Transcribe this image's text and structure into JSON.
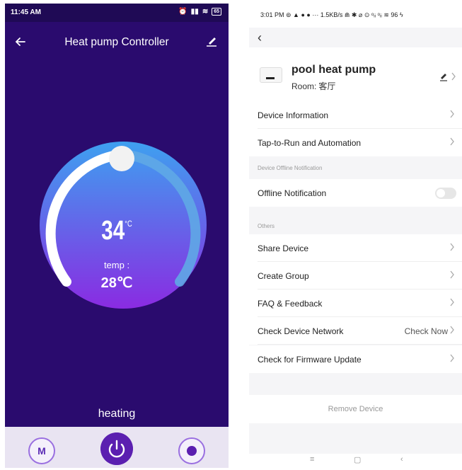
{
  "left_phone": {
    "status": {
      "time": "11:45 AM",
      "battery": "65"
    },
    "header": {
      "title": "Heat pump Controller",
      "back_icon": "arrow-left-icon",
      "edit_icon": "pencil-icon"
    },
    "dial": {
      "set_value": "34",
      "unit": "°C",
      "current_label": "temp :",
      "current_value": "28℃"
    },
    "mode": "heating",
    "bottom": {
      "mode_button": "M",
      "power_icon": "power-icon",
      "timer_icon": "timer-icon"
    },
    "colors": {
      "background": "#2a0b6e",
      "accent": "#5b1fb0",
      "dial_start": "#3ea0f0",
      "dial_end": "#8a2be2"
    }
  },
  "right_phone": {
    "status": {
      "text": "3:01 PM ⊚ ▲ ● ● ··· 1.5KB/s ⋒ ✱ ⌀ ⊙ ᵒᵢᵢ ᵒᵢᵢ ≋ 96 ϟ"
    },
    "device": {
      "name": "pool heat pump",
      "room_label": "Room:",
      "room_value": "客厅"
    },
    "rows": [
      {
        "label": "Device Information"
      },
      {
        "label": "Tap-to-Run and Automation"
      }
    ],
    "offline_section": {
      "header": "Device Offline Notification",
      "label": "Offline Notification",
      "enabled": false
    },
    "others_section": {
      "header": "Others",
      "rows": [
        {
          "label": "Share Device"
        },
        {
          "label": "Create Group"
        },
        {
          "label": "FAQ & Feedback"
        },
        {
          "label": "Check Device Network",
          "value": "Check Now"
        },
        {
          "label": "Check for Firmware Update"
        }
      ]
    },
    "remove_label": "Remove Device",
    "navbar": {
      "menu": "≡",
      "home": "▢",
      "back": "‹"
    }
  }
}
